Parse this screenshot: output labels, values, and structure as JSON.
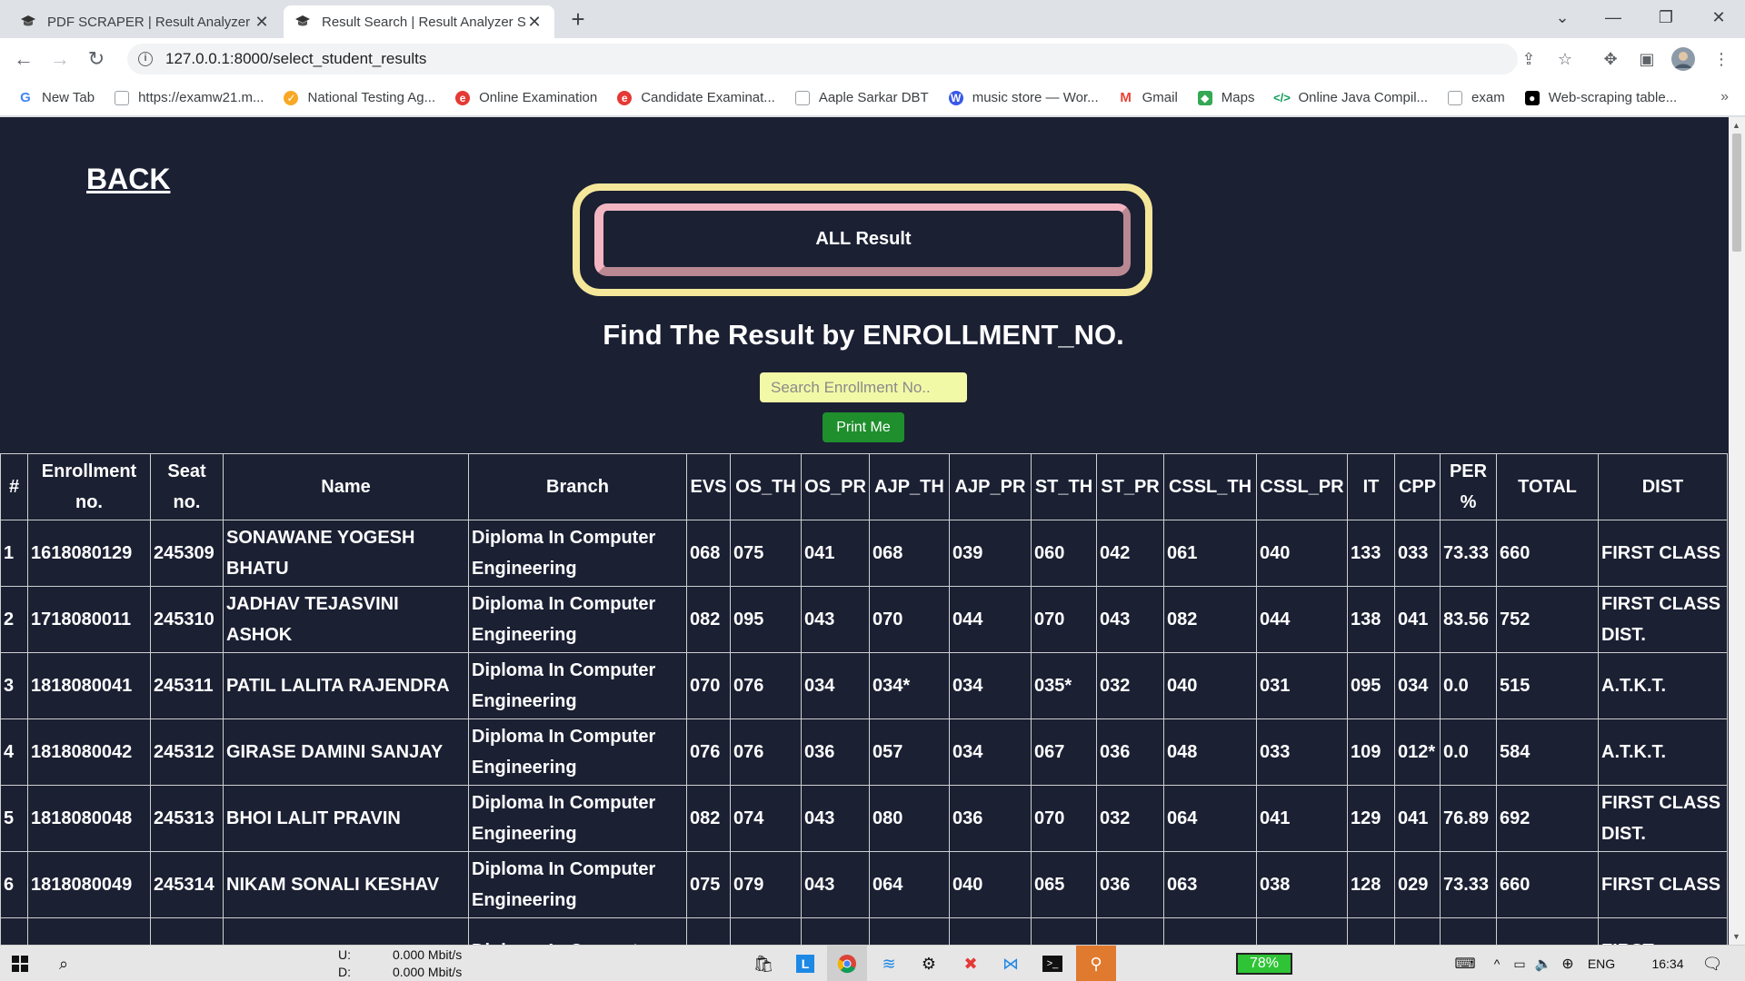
{
  "browser": {
    "tabs": [
      {
        "title": "PDF SCRAPER | Result Analyzer S"
      },
      {
        "title": "Result Search | Result Analyzer S"
      }
    ],
    "url": "127.0.0.1:8000/select_student_results",
    "bookmarks": [
      {
        "label": "New Tab",
        "icon": "google-icon",
        "color": "#4285f4"
      },
      {
        "label": "https://examw21.m...",
        "icon": "page-icon",
        "color": "#9aa0a6"
      },
      {
        "label": "National Testing Ag...",
        "icon": "nta-icon",
        "color": "#f9a825"
      },
      {
        "label": "Online Examination",
        "icon": "exam-icon",
        "color": "#e53935"
      },
      {
        "label": "Candidate Examinat...",
        "icon": "exam-icon",
        "color": "#e53935"
      },
      {
        "label": "Aaple Sarkar DBT",
        "icon": "page-icon",
        "color": "#9aa0a6"
      },
      {
        "label": "music store — Wor...",
        "icon": "wordpress-icon",
        "color": "#3858e9"
      },
      {
        "label": "Gmail",
        "icon": "gmail-icon",
        "color": "#ea4335"
      },
      {
        "label": "Maps",
        "icon": "maps-icon",
        "color": "#34a853"
      },
      {
        "label": "Online Java Compil...",
        "icon": "code-icon",
        "color": "#0f9d58"
      },
      {
        "label": "exam",
        "icon": "page-icon",
        "color": "#9aa0a6"
      },
      {
        "label": "Web-scraping table...",
        "icon": "medium-icon",
        "color": "#000000"
      }
    ]
  },
  "page": {
    "back_label": "BACK",
    "all_result_label": "ALL Result",
    "find_title": "Find The Result by ENROLLMENT_NO.",
    "search_placeholder": "Search Enrollment No..",
    "print_label": "Print Me"
  },
  "table": {
    "headers": [
      {
        "key": "idx",
        "label": "#"
      },
      {
        "key": "enroll",
        "label": "Enrollment no."
      },
      {
        "key": "seat",
        "label": "Seat no."
      },
      {
        "key": "name",
        "label": "Name"
      },
      {
        "key": "branch",
        "label": "Branch"
      },
      {
        "key": "evs",
        "label": "EVS"
      },
      {
        "key": "os_th",
        "label": "OS_TH"
      },
      {
        "key": "os_pr",
        "label": "OS_PR"
      },
      {
        "key": "ajp_th",
        "label": "AJP_TH"
      },
      {
        "key": "ajp_pr",
        "label": "AJP_PR"
      },
      {
        "key": "st_th",
        "label": "ST_TH"
      },
      {
        "key": "st_pr",
        "label": "ST_PR"
      },
      {
        "key": "cssl_th",
        "label": "CSSL_TH"
      },
      {
        "key": "cssl_pr",
        "label": "CSSL_PR"
      },
      {
        "key": "it",
        "label": "IT"
      },
      {
        "key": "cpp",
        "label": "CPP"
      },
      {
        "key": "per",
        "label": "PER %"
      },
      {
        "key": "total",
        "label": "TOTAL"
      },
      {
        "key": "dist",
        "label": "DIST"
      }
    ],
    "rows": [
      [
        "1",
        "1618080129",
        "245309",
        "SONAWANE YOGESH BHATU",
        "Diploma In Computer Engineering",
        "068",
        "075",
        "041",
        "068",
        "039",
        "060",
        "042",
        "061",
        "040",
        "133",
        "033",
        "73.33",
        "660",
        "FIRST CLASS"
      ],
      [
        "2",
        "1718080011",
        "245310",
        "JADHAV TEJASVINI ASHOK",
        "Diploma In Computer Engineering",
        "082",
        "095",
        "043",
        "070",
        "044",
        "070",
        "043",
        "082",
        "044",
        "138",
        "041",
        "83.56",
        "752",
        "FIRST CLASS DIST."
      ],
      [
        "3",
        "1818080041",
        "245311",
        "PATIL LALITA RAJENDRA",
        "Diploma In Computer Engineering",
        "070",
        "076",
        "034",
        "034*",
        "034",
        "035*",
        "032",
        "040",
        "031",
        "095",
        "034",
        "0.0",
        "515",
        "A.T.K.T."
      ],
      [
        "4",
        "1818080042",
        "245312",
        "GIRASE DAMINI SANJAY",
        "Diploma In Computer Engineering",
        "076",
        "076",
        "036",
        "057",
        "034",
        "067",
        "036",
        "048",
        "033",
        "109",
        "012*",
        "0.0",
        "584",
        "A.T.K.T."
      ],
      [
        "5",
        "1818080048",
        "245313",
        "BHOI LALIT PRAVIN",
        "Diploma In Computer Engineering",
        "082",
        "074",
        "043",
        "080",
        "036",
        "070",
        "032",
        "064",
        "041",
        "129",
        "041",
        "76.89",
        "692",
        "FIRST CLASS DIST."
      ],
      [
        "6",
        "1818080049",
        "245314",
        "NIKAM SONALI KESHAV",
        "Diploma In Computer Engineering",
        "075",
        "079",
        "043",
        "064",
        "040",
        "065",
        "036",
        "063",
        "038",
        "128",
        "029",
        "73.33",
        "660",
        "FIRST CLASS"
      ],
      [
        "",
        "",
        "",
        "",
        "Diploma In Computer",
        "",
        "",
        "",
        "",
        "",
        "",
        "",
        "",
        "",
        "",
        "",
        "",
        "",
        "FIRST"
      ]
    ]
  },
  "taskbar": {
    "net_up_label": "U:",
    "net_up": "0.000 Mbit/s",
    "net_down_label": "D:",
    "net_down": "0.000 Mbit/s",
    "battery": "78%",
    "lang": "ENG",
    "time": "16:34"
  }
}
